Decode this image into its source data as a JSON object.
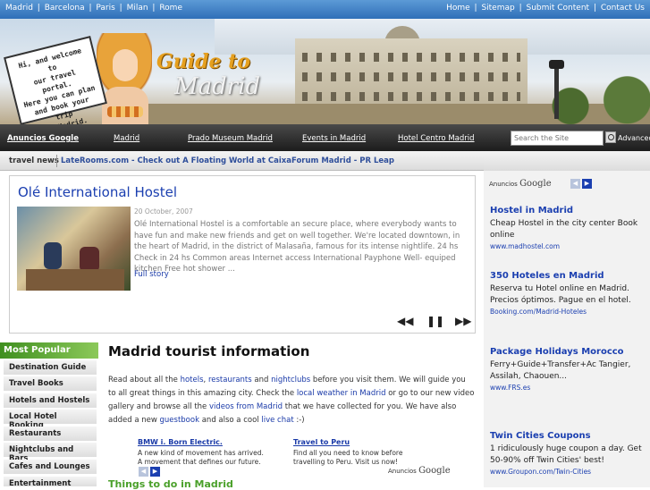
{
  "topbar": {
    "cities": [
      "Madrid",
      "Barcelona",
      "Paris",
      "Milan",
      "Rome"
    ],
    "links": [
      "Home",
      "Sitemap",
      "Submit Content",
      "Contact Us"
    ]
  },
  "header": {
    "sign_lines": [
      "Hi, and welcome to",
      "our travel portal.",
      "Here you can plan",
      "and book your trip",
      "to Madrid."
    ],
    "logo_line1": "Guide to",
    "logo_line2": "Madrid"
  },
  "nav": {
    "items": [
      "Anuncios Google",
      "Madrid",
      "Prado Museum Madrid",
      "Events in Madrid",
      "Hotel Centro Madrid"
    ],
    "search_placeholder": "Search the Site",
    "advanced_label": "Advanced"
  },
  "newsbar": {
    "label": "travel news",
    "headline": "LateRooms.com - Check out A Floating World at CaixaForum Madrid - PR Leap"
  },
  "feature": {
    "title": "Olé International Hostel",
    "date": "20 October, 2007",
    "body": "Olé International Hostel is a comfortable an secure place, where everybody wants to have fun and make new friends and get on well together. We're located downtown, in the heart of Madrid, in the district of Malasaña, famous for its intense nightlife. 24 hs Check in 24 hs Common areas Internet access International Payphone Well- equiped kitchen Free hot shower ...",
    "more": "Full story"
  },
  "sidebar": {
    "heading": "Most Popular",
    "items": [
      "Destination Guide",
      "Travel Books",
      "Hotels and Hostels",
      "Local Hotel Booking",
      "Restaurants",
      "Nightclubs and Bars",
      "Cafes and Lounges",
      "Entertainment"
    ]
  },
  "main": {
    "title": "Madrid tourist information",
    "intro": {
      "t1": "Read about all the ",
      "l1": "hotels",
      "t2": ", ",
      "l2": "restaurants",
      "t3": " and ",
      "l3": "nightclubs",
      "t4": " before you visit them. We will guide you to all great things in this amazing city. Check the ",
      "l4": "local weather in Madrid",
      "t5": " or go to our new video gallery and browse all the ",
      "l5": "videos from Madrid",
      "t6": " that we have collected for you. We have also added a new ",
      "l6": "guestbook",
      "t7": " and also a cool ",
      "l7": "live chat",
      "t8": " :-)"
    },
    "ads": [
      {
        "title": "BMW i. Born Electric.",
        "body": "A new kind of movement has arrived. A movement that defines our future."
      },
      {
        "title": "Travel to Peru",
        "body": "Find all you need to know before travelling to Peru. Visit us now!"
      }
    ],
    "ads_by": "Anuncios",
    "ads_brand": "Google",
    "things": "Things to do in Madrid"
  },
  "right": {
    "ads_by": "Anuncios",
    "ads_brand": "Google",
    "ads": [
      {
        "title": "Hostel in Madrid",
        "body": "Cheap Hostel in the city center Book online",
        "url": "www.madhostel.com"
      },
      {
        "title": "350 Hoteles en Madrid",
        "body": "Reserva tu Hotel online en Madrid. Precios óptimos. Pague en el hotel.",
        "url": "Booking.com/Madrid-Hoteles"
      },
      {
        "title": "Package Holidays Morocco",
        "body": "Ferry+Guide+Transfer+Ac Tangier, Assilah, Chaouen...",
        "url": "www.FRS.es"
      },
      {
        "title": "Twin Cities Coupons",
        "body": "1 ridiculously huge coupon a day. Get 50-90% off Twin Cities' best!",
        "url": "www.Groupon.com/Twin-Cities"
      }
    ]
  },
  "colors": {
    "topbar": "#3a7cc4",
    "link": "#1a3aa8",
    "sidebar_head": "#5aa83a",
    "things": "#4aa02a"
  }
}
